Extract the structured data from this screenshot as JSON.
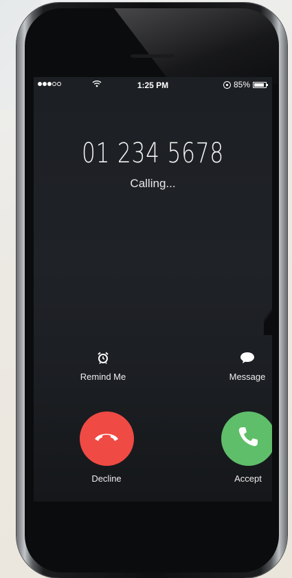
{
  "status_bar": {
    "signal_dots": [
      true,
      true,
      true,
      false,
      false
    ],
    "time": "1:25 PM",
    "battery_percent": "85%",
    "battery_level": 0.85
  },
  "call": {
    "number": "01 234 5678",
    "status": "Calling..."
  },
  "actions": {
    "remind_label": "Remind Me",
    "remind_icon": "alarm-clock-icon",
    "message_label": "Message",
    "message_icon": "speech-bubble-icon"
  },
  "buttons": {
    "decline_label": "Decline",
    "decline_color": "#ef4a44",
    "accept_label": "Accept",
    "accept_color": "#5fbe6a"
  }
}
